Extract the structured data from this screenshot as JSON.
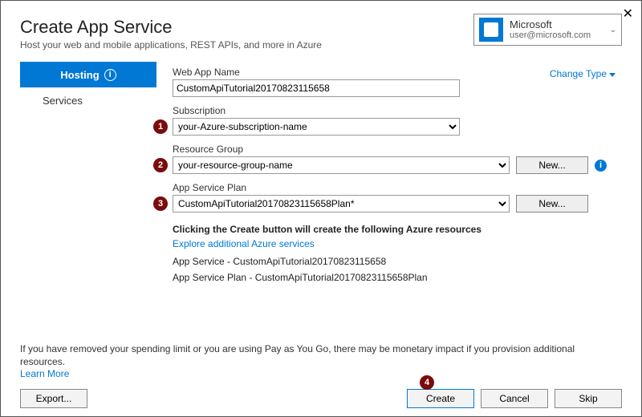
{
  "header": {
    "title": "Create App Service",
    "subtitle": "Host your web and mobile applications, REST APIs, and more in Azure"
  },
  "account": {
    "name": "Microsoft",
    "email": "user@microsoft.com"
  },
  "sidebar": {
    "items": [
      {
        "label": "Hosting",
        "active": true
      },
      {
        "label": "Services",
        "active": false
      }
    ]
  },
  "form": {
    "change_type": "Change Type",
    "web_app_name_label": "Web App Name",
    "web_app_name_value": "CustomApiTutorial20170823115658",
    "subscription_label": "Subscription",
    "subscription_value": "your-Azure-subscription-name",
    "resource_group_label": "Resource Group",
    "resource_group_value": "your-resource-group-name",
    "app_service_plan_label": "App Service Plan",
    "app_service_plan_value": "CustomApiTutorial20170823115658Plan*",
    "new_button": "New..."
  },
  "summary": {
    "heading": "Clicking the Create button will create the following Azure resources",
    "link": "Explore additional Azure services",
    "line1": "App Service - CustomApiTutorial20170823115658",
    "line2": "App Service Plan - CustomApiTutorial20170823115658Plan"
  },
  "footer": {
    "disclaimer": "If you have removed your spending limit or you are using Pay as You Go, there may be monetary impact if you provision additional resources.",
    "learn_more": "Learn More",
    "export": "Export...",
    "create": "Create",
    "cancel": "Cancel",
    "skip": "Skip"
  },
  "callouts": {
    "1": "1",
    "2": "2",
    "3": "3",
    "4": "4"
  }
}
